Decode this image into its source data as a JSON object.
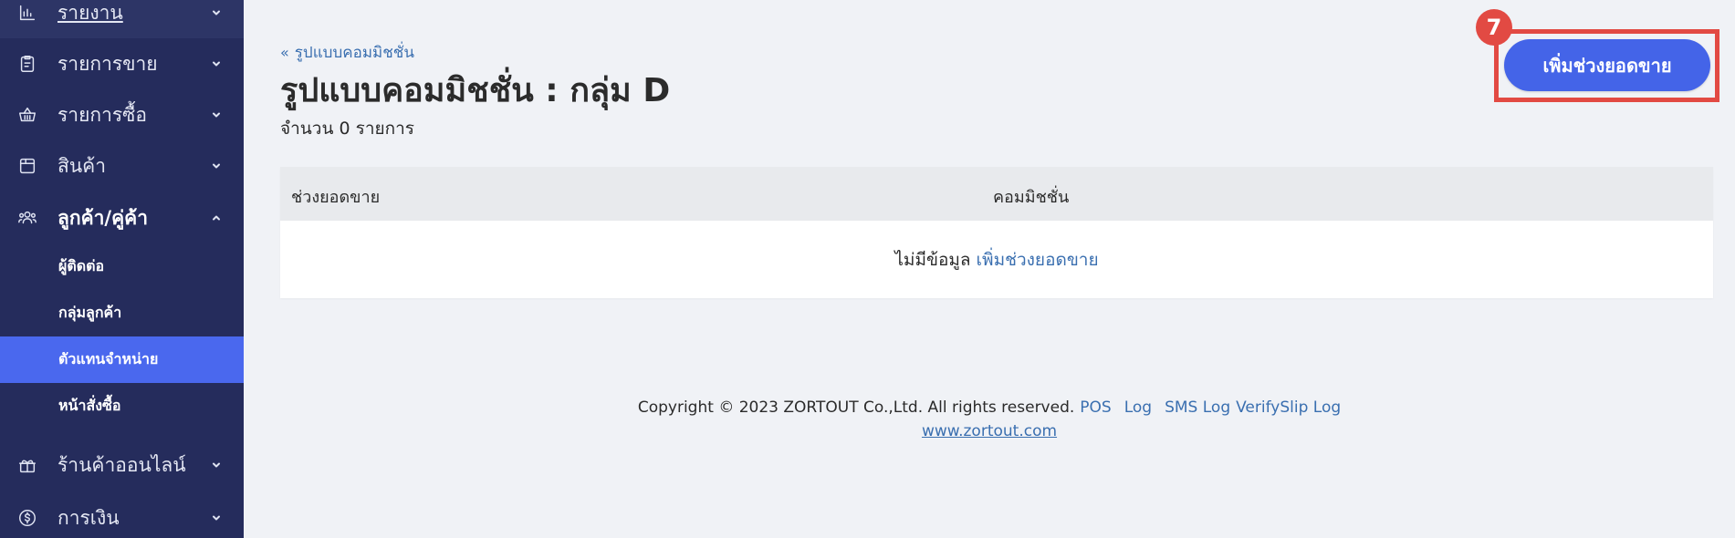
{
  "sidebar": {
    "items": [
      {
        "label": "รายงาน",
        "icon": "bar-chart-icon"
      },
      {
        "label": "รายการขาย",
        "icon": "clipboard-icon"
      },
      {
        "label": "รายการซื้อ",
        "icon": "basket-icon"
      },
      {
        "label": "สินค้า",
        "icon": "box-icon"
      },
      {
        "label": "ลูกค้า/คู่ค้า",
        "icon": "users-icon"
      },
      {
        "label": "ร้านค้าออนไลน์",
        "icon": "gift-store-icon"
      },
      {
        "label": "การเงิน",
        "icon": "coin-icon"
      }
    ],
    "sub_items": [
      {
        "label": "ผู้ติดต่อ"
      },
      {
        "label": "กลุ่มลูกค้า"
      },
      {
        "label": "ตัวแทนจำหน่าย"
      },
      {
        "label": "หน้าสั่งซื้อ"
      }
    ]
  },
  "header": {
    "back_label": "รูปแบบคอมมิชชั่น",
    "title": "รูปแบบคอมมิชชั่น : กลุ่ม D",
    "count_text": "จำนวน 0 รายการ",
    "add_button_label": "เพิ่มช่วงยอดขาย",
    "step_badge": "7"
  },
  "table": {
    "columns": [
      "ช่วงยอดขาย",
      "คอมมิชชั่น"
    ],
    "empty_text": "ไม่มีข้อมูล",
    "empty_link": "เพิ่มช่วงยอดขาย"
  },
  "footer": {
    "copyright": "Copyright © 2023 ZORTOUT Co.,Ltd. All rights reserved.",
    "links": [
      "POS",
      "Log",
      "SMS Log",
      "VerifySlip Log"
    ],
    "website": "www.zortout.com"
  },
  "colors": {
    "sidebar_bg": "#252c5c",
    "accent": "#4464e8",
    "highlight": "#e24a43",
    "link": "#3a6fb0"
  }
}
